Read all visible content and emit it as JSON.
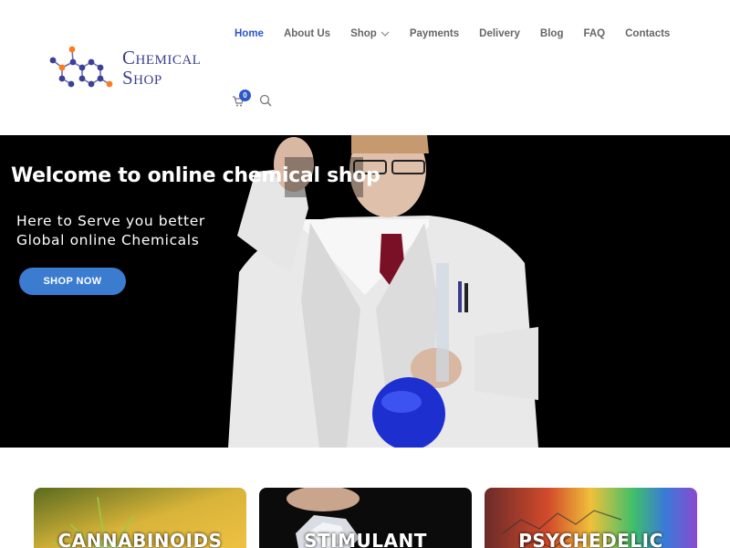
{
  "logo": {
    "line1": "Chemical",
    "line2": "Shop"
  },
  "nav": {
    "items": [
      {
        "label": "Home",
        "active": true
      },
      {
        "label": "About Us"
      },
      {
        "label": "Shop",
        "has_dropdown": true
      },
      {
        "label": "Payments"
      },
      {
        "label": "Delivery"
      },
      {
        "label": "Blog"
      },
      {
        "label": "FAQ"
      },
      {
        "label": "Contacts"
      }
    ]
  },
  "cart": {
    "count": "0",
    "icon": "cart-icon"
  },
  "search": {
    "icon": "search-icon"
  },
  "hero": {
    "title": "Welcome to online chemical shop",
    "subtitle_line1": "Here to Serve you better",
    "subtitle_line2": "Global online Chemicals",
    "cta": "SHOP NOW"
  },
  "categories": [
    {
      "label": "CANNABINOIDS"
    },
    {
      "label": "STIMULANT"
    },
    {
      "label": "PSYCHEDELIC"
    }
  ],
  "colors": {
    "accent": "#2d56c8",
    "button": "#3b7bd0",
    "logo_text": "#3a3f8f",
    "hero_bg": "#000000"
  }
}
